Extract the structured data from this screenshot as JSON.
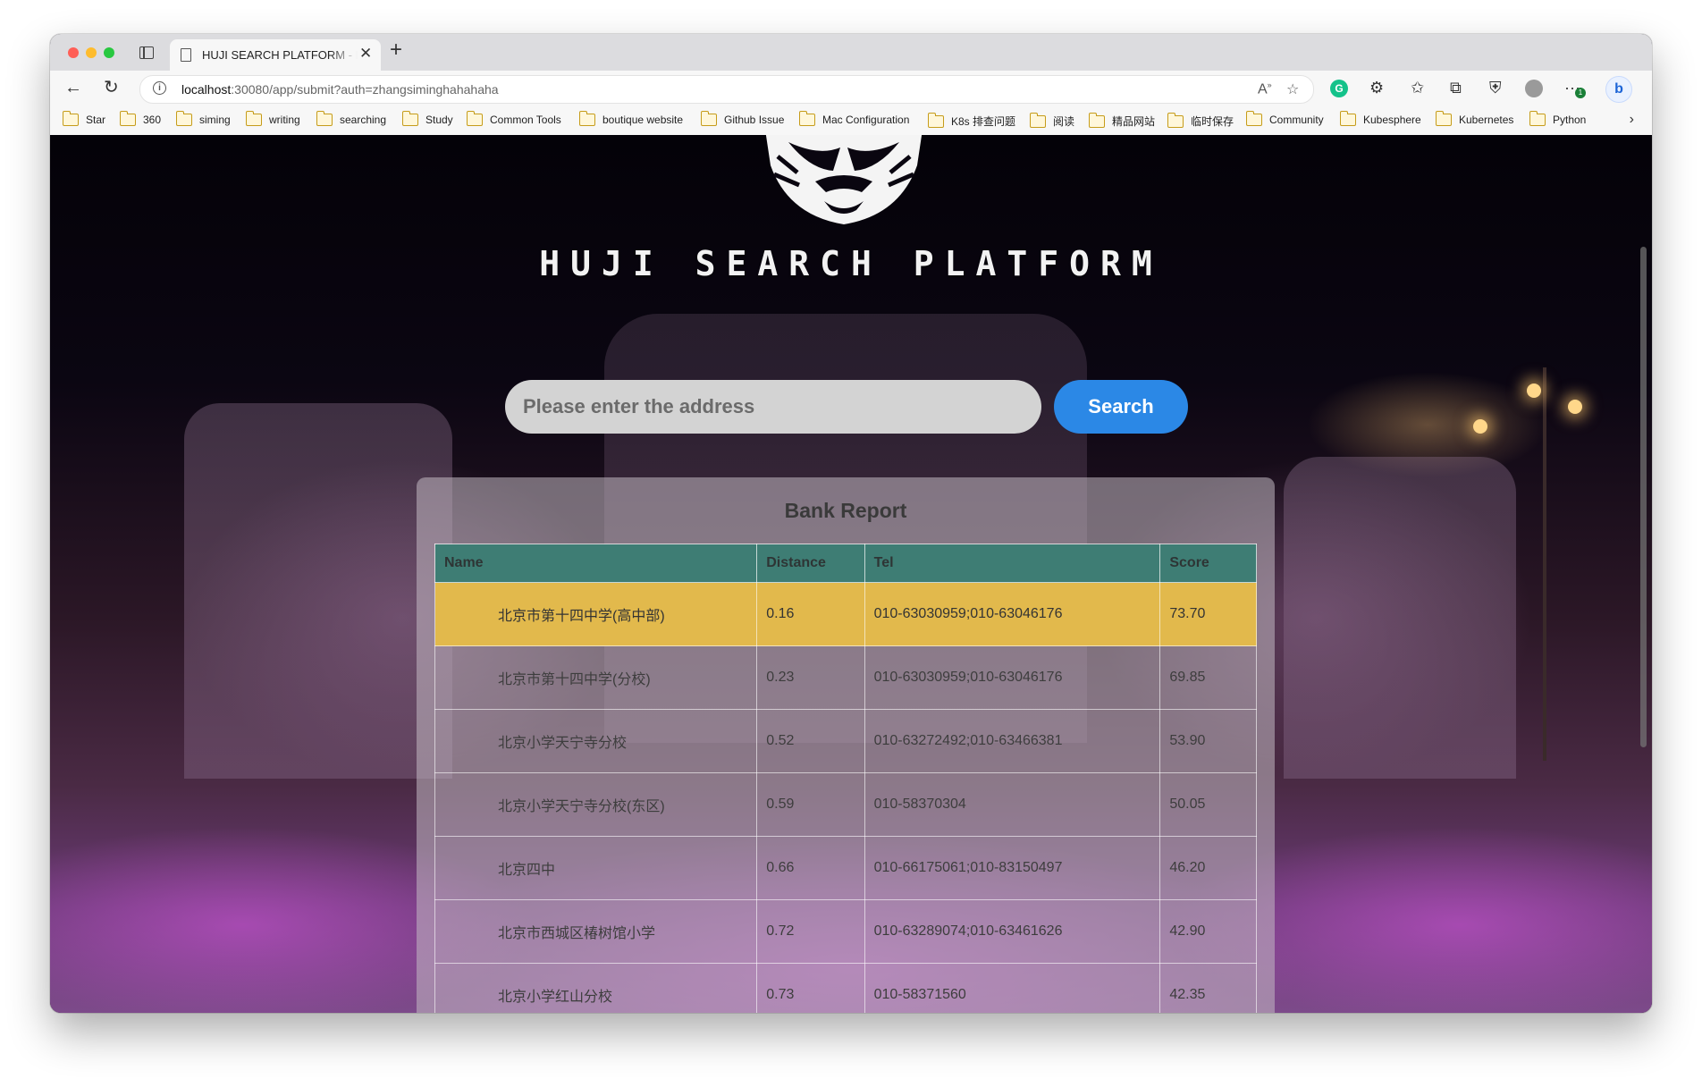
{
  "browser": {
    "tab_title": "HUJI SEARCH PLATFORM - Re",
    "url_host": "localhost",
    "url_path": ":30080/app/submit?auth=zhangsiminghahahaha",
    "bookmarks": [
      "Star",
      "360",
      "siming",
      "writing",
      "searching",
      "Study",
      "Common Tools",
      "boutique website",
      "Github Issue",
      "Mac Configuration",
      "K8s 排查问题",
      "阅读",
      "精品网站",
      "临时保存",
      "Community",
      "Kubesphere",
      "Kubernetes",
      "Python"
    ],
    "ext_badge": "1"
  },
  "page": {
    "title": "HUJI SEARCH PLATFORM",
    "search_placeholder": "Please enter the address",
    "search_button": "Search",
    "report_title": "Bank Report",
    "columns": [
      "Name",
      "Distance",
      "Tel",
      "Score"
    ],
    "rows": [
      {
        "name": "北京市第十四中学(高中部)",
        "distance": "0.16",
        "tel": "010-63030959;010-63046176",
        "score": "73.70",
        "highlight": true
      },
      {
        "name": "北京市第十四中学(分校)",
        "distance": "0.23",
        "tel": "010-63030959;010-63046176",
        "score": "69.85"
      },
      {
        "name": "北京小学天宁寺分校",
        "distance": "0.52",
        "tel": "010-63272492;010-63466381",
        "score": "53.90"
      },
      {
        "name": "北京小学天宁寺分校(东区)",
        "distance": "0.59",
        "tel": "010-58370304",
        "score": "50.05"
      },
      {
        "name": "北京四中",
        "distance": "0.66",
        "tel": "010-66175061;010-83150497",
        "score": "46.20"
      },
      {
        "name": "北京市西城区椿树馆小学",
        "distance": "0.72",
        "tel": "010-63289074;010-63461626",
        "score": "42.90"
      },
      {
        "name": "北京小学红山分校",
        "distance": "0.73",
        "tel": "010-58371560",
        "score": "42.35"
      },
      {
        "name": "",
        "distance": "",
        "tel": "",
        "score": ""
      }
    ]
  },
  "colors": {
    "header_bg": "#3e7d74",
    "highlight_row": "#e2b94c",
    "search_button": "#2b88e6",
    "search_input": "#d3d3d3"
  },
  "icons": [
    "back-arrow-icon",
    "reload-icon",
    "info-icon",
    "read-aloud-icon",
    "favorite-add-icon",
    "grammarly-icon",
    "extensions-icon",
    "favorites-icon",
    "collections-icon",
    "browser-essentials-icon",
    "profile-avatar-icon",
    "more-menu-icon",
    "bing-copilot-icon",
    "folder-icon",
    "tiger-logo-icon"
  ]
}
